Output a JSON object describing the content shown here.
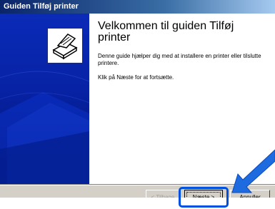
{
  "window": {
    "title": "Guiden Tilføj printer"
  },
  "content": {
    "heading": "Velkommen til guiden Tilføj printer",
    "description": "Denne guide hjælper dig med at installere en printer eller tilslutte printere.",
    "hint": "Klik på Næste for at fortsætte."
  },
  "buttons": {
    "back_label": "< Tilbage",
    "next_label": "Næste >",
    "cancel_label": "Annuller"
  },
  "icons": {
    "printer": "printer-icon",
    "pointer": "arrow-pointer-icon"
  },
  "colors": {
    "titlebar": "#0a246a",
    "banner": "#0722a4",
    "highlight": "#0050e0"
  }
}
